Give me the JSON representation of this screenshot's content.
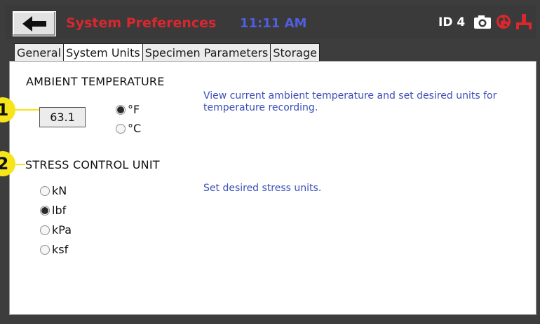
{
  "header": {
    "title": "System Preferences",
    "time": "11:11 AM",
    "id_label": "ID 4",
    "back_icon": "back-arrow-icon",
    "camera_icon": "camera-icon",
    "globe_icon": "globe-icon",
    "network_icon": "network-icon"
  },
  "tabs": [
    {
      "label": "General",
      "active": false
    },
    {
      "label": "System Units",
      "active": true
    },
    {
      "label": "Specimen Parameters",
      "active": false
    },
    {
      "label": "Storage",
      "active": false
    }
  ],
  "ambient": {
    "title": "AMBIENT TEMPERATURE",
    "value": "63.1",
    "options": [
      {
        "label": "°F",
        "selected": true
      },
      {
        "label": "°C",
        "selected": false
      }
    ],
    "description": "View current ambient temperature and set desired units for temperature recording."
  },
  "stress": {
    "title": "STRESS CONTROL UNIT",
    "options": [
      {
        "label": "kN",
        "selected": false
      },
      {
        "label": "lbf",
        "selected": true
      },
      {
        "label": "kPa",
        "selected": false
      },
      {
        "label": "ksf",
        "selected": false
      }
    ],
    "description": "Set desired stress units."
  },
  "callouts": [
    "1",
    "2"
  ],
  "colors": {
    "title_red": "#d8282e",
    "clock_blue": "#4f5fe0",
    "desc_blue": "#3b4fb8",
    "callout_yellow": "#f6e51a"
  }
}
